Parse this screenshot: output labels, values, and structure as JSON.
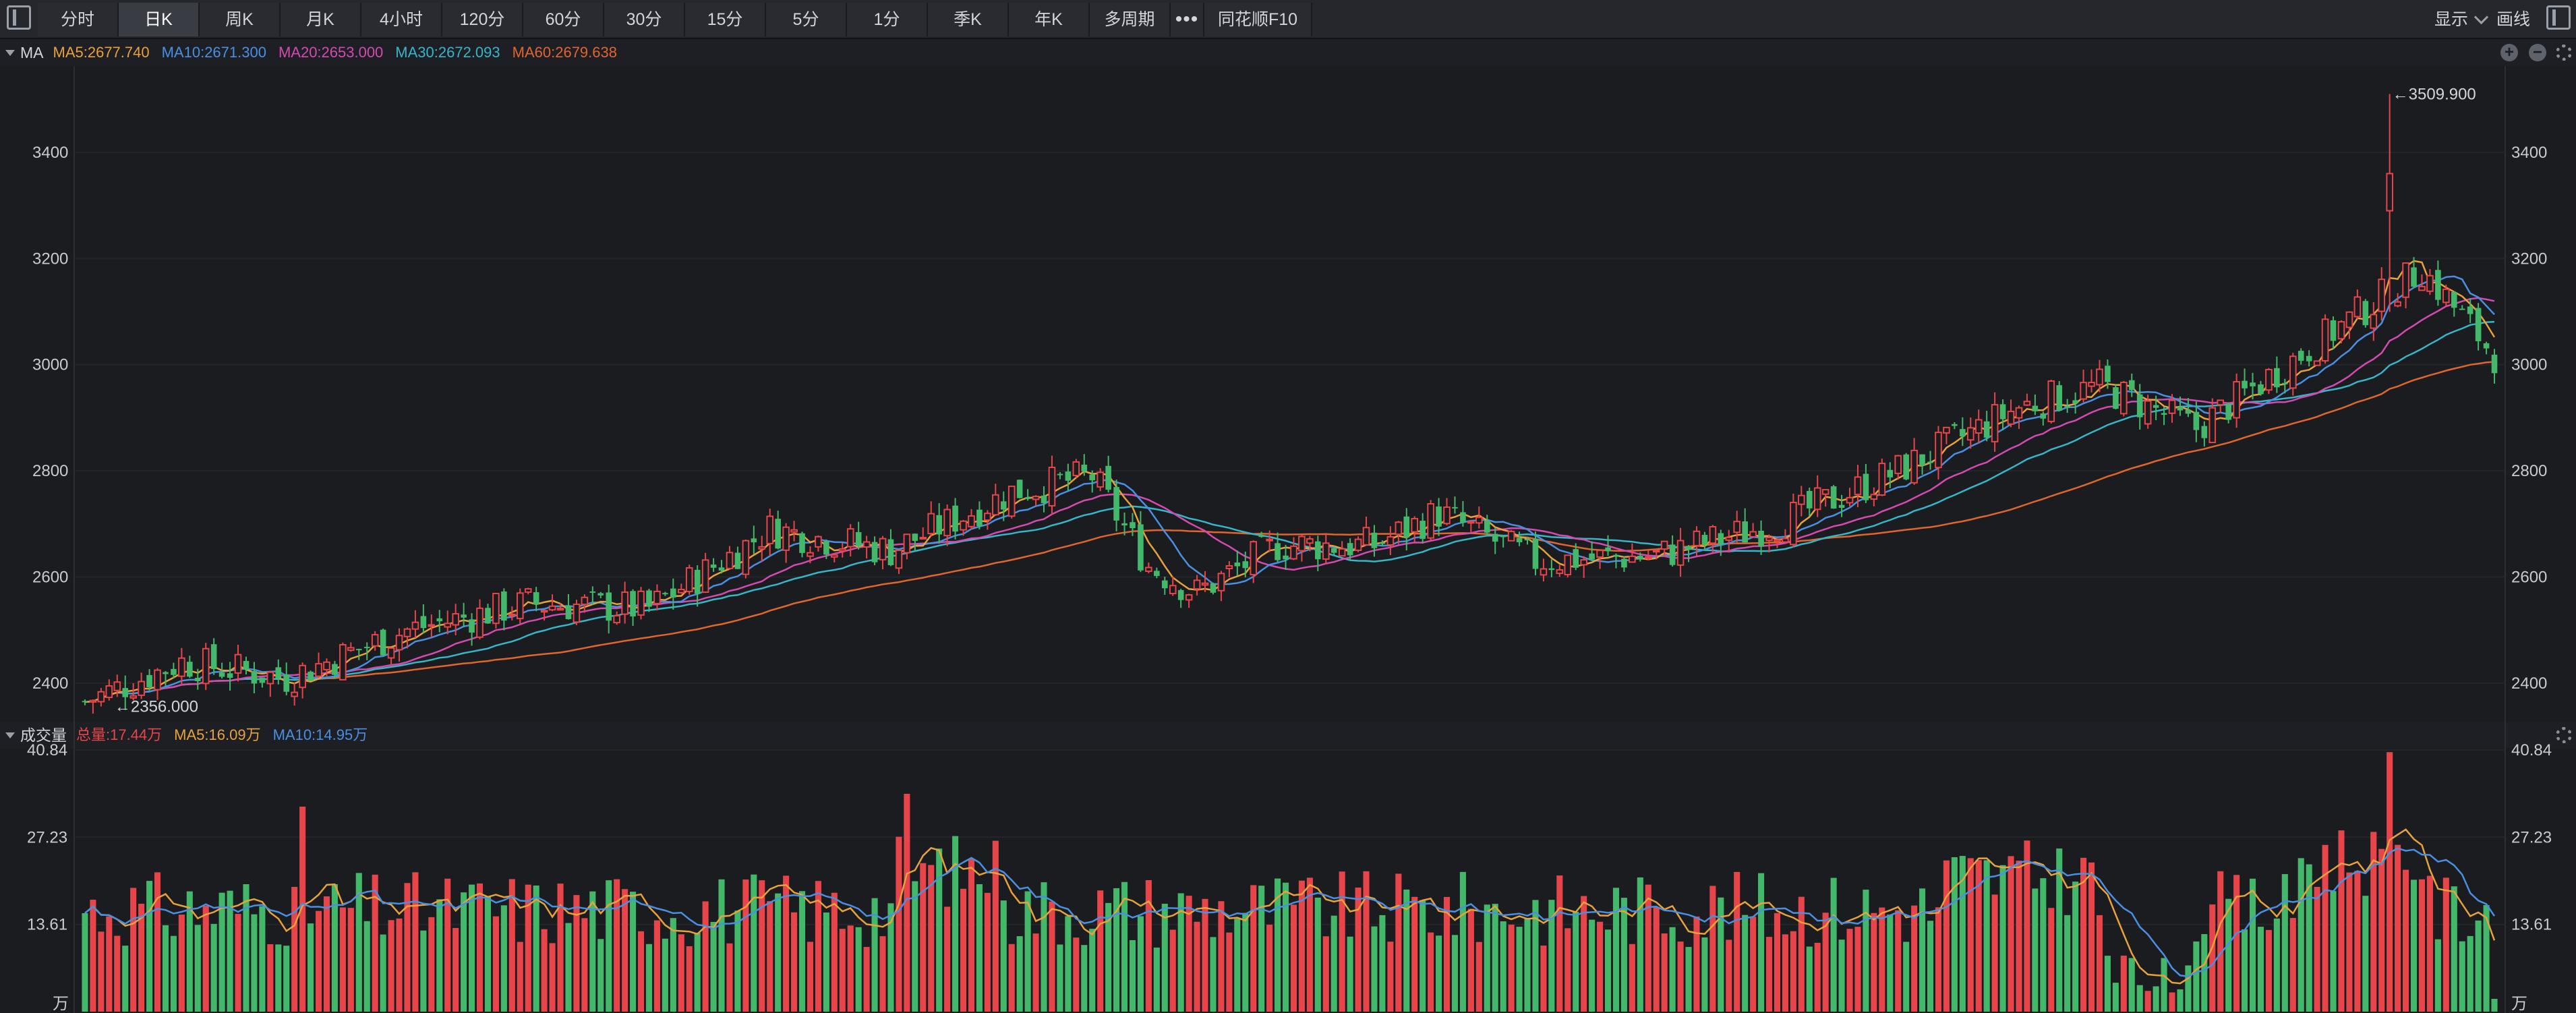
{
  "toolbar": {
    "tabs": [
      {
        "label": "分时",
        "w": 0
      },
      {
        "label": "日K"
      },
      {
        "label": "周K"
      },
      {
        "label": "月K"
      },
      {
        "label": "4小时"
      },
      {
        "label": "120分"
      },
      {
        "label": "60分"
      },
      {
        "label": "30分"
      },
      {
        "label": "15分"
      },
      {
        "label": "5分"
      },
      {
        "label": "1分"
      },
      {
        "label": "季K"
      },
      {
        "label": "年K"
      },
      {
        "label": "多周期"
      },
      {
        "label": "•••"
      },
      {
        "label": "同花顺F10"
      }
    ],
    "active_tab": "日K",
    "display_label": "显示",
    "draw_label": "画线"
  },
  "main_legend": {
    "title": "MA",
    "items": [
      {
        "label": "MA5:2677.740",
        "color": "#e8a23c"
      },
      {
        "label": "MA10:2671.300",
        "color": "#4a90e2"
      },
      {
        "label": "MA20:2653.000",
        "color": "#d44bb0"
      },
      {
        "label": "MA30:2672.093",
        "color": "#36b6c9"
      },
      {
        "label": "MA60:2679.638",
        "color": "#e0662e"
      }
    ]
  },
  "volume_legend": {
    "title": "成交量",
    "items": [
      {
        "label": "总量:17.44万",
        "color": "#e8454a"
      },
      {
        "label": "MA5:16.09万",
        "color": "#e8a23c"
      },
      {
        "label": "MA10:14.95万",
        "color": "#4a90e2"
      }
    ]
  },
  "chart_data": [
    {
      "type": "candlestick",
      "ylim": [
        2330,
        3560
      ],
      "y_ticks": [
        2400,
        2600,
        2800,
        3000,
        3200,
        3400
      ],
      "annotations": [
        {
          "label": "3509.900",
          "kind": "high"
        },
        {
          "label": "2356.000",
          "kind": "low"
        }
      ],
      "bars": 300,
      "high_value": 3509.9,
      "low_value": 2356.0,
      "anchors": [
        [
          0,
          2365
        ],
        [
          12,
          2440
        ],
        [
          25,
          2410
        ],
        [
          40,
          2500
        ],
        [
          55,
          2550
        ],
        [
          70,
          2540
        ],
        [
          85,
          2690
        ],
        [
          100,
          2650
        ],
        [
          115,
          2760
        ],
        [
          125,
          2790
        ],
        [
          132,
          2620
        ],
        [
          138,
          2570
        ],
        [
          148,
          2660
        ],
        [
          160,
          2660
        ],
        [
          168,
          2720
        ],
        [
          180,
          2630
        ],
        [
          195,
          2640
        ],
        [
          210,
          2700
        ],
        [
          225,
          2800
        ],
        [
          240,
          2920
        ],
        [
          250,
          2960
        ],
        [
          262,
          2880
        ],
        [
          275,
          3020
        ],
        [
          290,
          3180
        ],
        [
          300,
          3000
        ]
      ],
      "up_color": "#e8454a",
      "down_color": "#44b86a",
      "ma_colors": {
        "MA5": "#e8a23c",
        "MA10": "#4a90e2",
        "MA20": "#d44bb0",
        "MA30": "#36b6c9",
        "MA60": "#e0662e"
      }
    },
    {
      "type": "bar",
      "name": "成交量",
      "ylim": [
        0,
        40.84
      ],
      "y_ticks": [
        "40.84",
        "27.23",
        "13.61"
      ],
      "unit": "万",
      "up_color": "#e8454a",
      "down_color": "#44b86a"
    }
  ]
}
